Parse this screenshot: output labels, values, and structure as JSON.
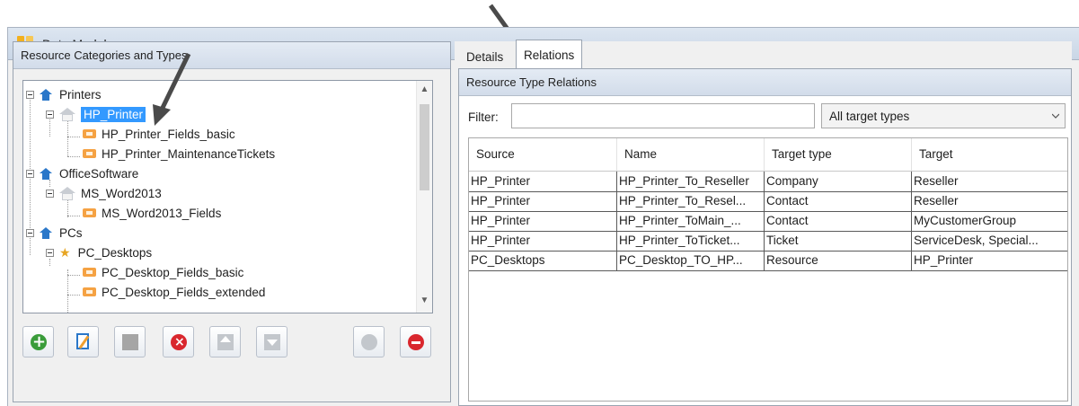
{
  "window": {
    "title": "Data Models"
  },
  "left_panel": {
    "title": "Resource Categories and Types",
    "tree": [
      {
        "label": "Printers"
      },
      {
        "label": "HP_Printer",
        "selected": true
      },
      {
        "label": "HP_Printer_Fields_basic"
      },
      {
        "label": "HP_Printer_MaintenanceTickets"
      },
      {
        "label": "OfficeSoftware"
      },
      {
        "label": "MS_Word2013"
      },
      {
        "label": "MS_Word2013_Fields"
      },
      {
        "label": "PCs"
      },
      {
        "label": "PC_Desktops"
      },
      {
        "label": "PC_Desktop_Fields_basic"
      },
      {
        "label": "PC_Desktop_Fields_extended"
      }
    ],
    "toolbar": [
      {
        "icon": "add-icon",
        "color": "#3a9c3a"
      },
      {
        "icon": "edit-icon",
        "color": "#2a77c9"
      },
      {
        "icon": "edit-form-icon",
        "color": "#9a9a9a"
      },
      {
        "icon": "delete-icon",
        "color": "#d9272e"
      },
      {
        "icon": "move-up-icon",
        "color": "#c3c7cc"
      },
      {
        "icon": "move-down-icon",
        "color": "#c3c7cc"
      },
      {
        "icon": "confirm-icon",
        "color": "#c3c7cc"
      },
      {
        "icon": "remove-icon",
        "color": "#d9272e"
      }
    ]
  },
  "right_panel": {
    "tabs": [
      {
        "label": "Details"
      },
      {
        "label": "Relations",
        "active": true
      }
    ],
    "section_title": "Resource Type Relations",
    "filter": {
      "label": "Filter:",
      "value": ""
    },
    "target_type_select": {
      "value": "All target types"
    },
    "grid": {
      "columns": [
        "Source",
        "Name",
        "Target type",
        "Target"
      ],
      "rows": [
        [
          "HP_Printer",
          "HP_Printer_To_Reseller",
          "Company",
          "Reseller"
        ],
        [
          "HP_Printer",
          "HP_Printer_To_Resel...",
          "Contact",
          "Reseller"
        ],
        [
          "HP_Printer",
          "HP_Printer_ToMain_...",
          "Contact",
          "MyCustomerGroup"
        ],
        [
          "HP_Printer",
          "HP_Printer_ToTicket...",
          "Ticket",
          "ServiceDesk, Special..."
        ],
        [
          "PC_Desktops",
          "PC_Desktop_TO_HP...",
          "Resource",
          "HP_Printer"
        ]
      ]
    }
  },
  "colors": {
    "selection": "#3399ff",
    "header_gradient_top": "#dde6f1",
    "accent_orange": "#f2b01e"
  }
}
